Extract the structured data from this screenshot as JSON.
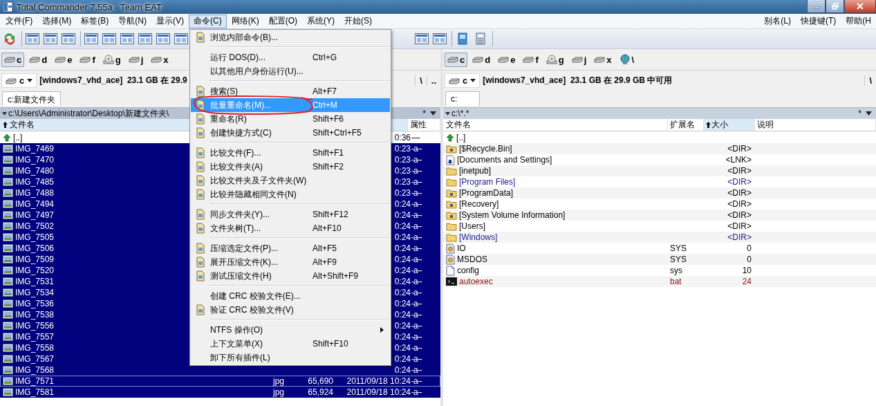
{
  "window": {
    "title": "Total Commander 7.55a - Team EAT"
  },
  "menubar": {
    "left": [
      {
        "label": "文件(F)",
        "selected": false
      },
      {
        "label": "选择(M)",
        "selected": false
      },
      {
        "label": "标签(B)",
        "selected": false
      },
      {
        "label": "导航(N)",
        "selected": false
      },
      {
        "label": "显示(V)",
        "selected": false
      },
      {
        "label": "命令(C)",
        "selected": true
      },
      {
        "label": "网络(K)",
        "selected": false
      },
      {
        "label": "配置(O)",
        "selected": false
      },
      {
        "label": "系统(Y)",
        "selected": false
      },
      {
        "label": "开始(S)",
        "selected": false
      }
    ],
    "right": [
      {
        "label": "别名(L)",
        "selected": false
      },
      {
        "label": "快捷键(T)",
        "selected": false
      },
      {
        "label": "帮助(H",
        "selected": false
      }
    ]
  },
  "panels": [
    {
      "drives": [
        {
          "label": "c",
          "kind": "hdd",
          "selected": true
        },
        {
          "label": "d",
          "kind": "hdd",
          "selected": false
        },
        {
          "label": "e",
          "kind": "hdd",
          "selected": false
        },
        {
          "label": "f",
          "kind": "hdd",
          "selected": false
        },
        {
          "label": "g",
          "kind": "cd",
          "selected": false
        },
        {
          "label": "j",
          "kind": "hdd",
          "selected": false
        },
        {
          "label": "x",
          "kind": "hdd",
          "selected": false
        }
      ],
      "drive_select": "c",
      "info": "[windows7_vhd_ace]  23.1 GB 在 29.9",
      "nav_buttons": [
        "\\",
        ".."
      ],
      "tab": "c:新建文件夹",
      "path": "c:\\Users\\Administrator\\Desktop\\新建文件夹\\",
      "active": true,
      "filter": "*",
      "columns": [
        {
          "label": "文件名",
          "kind": "name",
          "sorted": true
        },
        {
          "label": "属性",
          "kind": "attr",
          "sorted": false
        }
      ],
      "rows": [
        {
          "kind": "up",
          "name": "[..]",
          "date": "0:36",
          "attr": "----",
          "selected": false,
          "cursor": false
        },
        {
          "kind": "image",
          "name": "IMG_7469",
          "date": "0:23",
          "attr": "-a--",
          "selected": true,
          "cursor": false
        },
        {
          "kind": "image",
          "name": "IMG_7470",
          "date": "0:23",
          "attr": "-a--",
          "selected": true,
          "cursor": false
        },
        {
          "kind": "image",
          "name": "IMG_7480",
          "date": "0:23",
          "attr": "-a--",
          "selected": true,
          "cursor": false
        },
        {
          "kind": "image",
          "name": "IMG_7485",
          "date": "0:23",
          "attr": "-a--",
          "selected": true,
          "cursor": false
        },
        {
          "kind": "image",
          "name": "IMG_7488",
          "date": "0:23",
          "attr": "-a--",
          "selected": true,
          "cursor": false
        },
        {
          "kind": "image",
          "name": "IMG_7494",
          "date": "0:24",
          "attr": "-a--",
          "selected": true,
          "cursor": false
        },
        {
          "kind": "image",
          "name": "IMG_7497",
          "date": "0:24",
          "attr": "-a--",
          "selected": true,
          "cursor": false
        },
        {
          "kind": "image",
          "name": "IMG_7502",
          "date": "0:24",
          "attr": "-a--",
          "selected": true,
          "cursor": false
        },
        {
          "kind": "image",
          "name": "IMG_7505",
          "date": "0:24",
          "attr": "-a--",
          "selected": true,
          "cursor": false
        },
        {
          "kind": "image",
          "name": "IMG_7506",
          "date": "0:24",
          "attr": "-a--",
          "selected": true,
          "cursor": false
        },
        {
          "kind": "image",
          "name": "IMG_7509",
          "date": "0:24",
          "attr": "-a--",
          "selected": true,
          "cursor": false
        },
        {
          "kind": "image",
          "name": "IMG_7520",
          "date": "0:24",
          "attr": "-a--",
          "selected": true,
          "cursor": false
        },
        {
          "kind": "image",
          "name": "IMG_7531",
          "date": "0:24",
          "attr": "-a--",
          "selected": true,
          "cursor": false
        },
        {
          "kind": "image",
          "name": "IMG_7534",
          "date": "0:24",
          "attr": "-a--",
          "selected": true,
          "cursor": false
        },
        {
          "kind": "image",
          "name": "IMG_7536",
          "date": "0:24",
          "attr": "-a--",
          "selected": true,
          "cursor": false
        },
        {
          "kind": "image",
          "name": "IMG_7538",
          "date": "0:24",
          "attr": "-a--",
          "selected": true,
          "cursor": false
        },
        {
          "kind": "image",
          "name": "IMG_7556",
          "date": "0:24",
          "attr": "-a--",
          "selected": true,
          "cursor": false
        },
        {
          "kind": "image",
          "name": "IMG_7557",
          "date": "0:24",
          "attr": "-a--",
          "selected": true,
          "cursor": false
        },
        {
          "kind": "image",
          "name": "IMG_7558",
          "date": "0:24",
          "attr": "-a--",
          "selected": true,
          "cursor": false
        },
        {
          "kind": "image",
          "name": "IMG_7567",
          "date": "0:24",
          "attr": "-a--",
          "selected": true,
          "cursor": false
        },
        {
          "kind": "image",
          "name": "IMG_7568",
          "date": "0:24",
          "attr": "-a--",
          "selected": true,
          "cursor": false
        },
        {
          "kind": "image",
          "name": "IMG_7571",
          "ext": "jpg",
          "size": "65,690",
          "date": "2011/09/18 10:24",
          "attr": "-a--",
          "selected": true,
          "cursor": true
        },
        {
          "kind": "image",
          "name": "IMG_7581",
          "ext": "jpg",
          "size": "65,924",
          "date": "2011/09/18 10:24",
          "attr": "-a--",
          "selected": true,
          "cursor": false
        }
      ]
    },
    {
      "drives": [
        {
          "label": "c",
          "kind": "hdd",
          "selected": true
        },
        {
          "label": "d",
          "kind": "hdd",
          "selected": false
        },
        {
          "label": "e",
          "kind": "hdd",
          "selected": false
        },
        {
          "label": "f",
          "kind": "hdd",
          "selected": false
        },
        {
          "label": "g",
          "kind": "cd",
          "selected": false
        },
        {
          "label": "j",
          "kind": "hdd",
          "selected": false
        },
        {
          "label": "x",
          "kind": "hdd",
          "selected": false
        },
        {
          "label": "\\",
          "kind": "network",
          "selected": false
        }
      ],
      "drive_select": "c",
      "info": "[windows7_vhd_ace]  23.1 GB 在 29.9 GB 中可用",
      "nav_buttons": [
        "\\"
      ],
      "tab": "c:",
      "path": "c:\\*.*",
      "active": false,
      "filter": "*",
      "columns": [
        {
          "label": "文件名",
          "kind": "name",
          "sorted": false
        },
        {
          "label": "扩展名",
          "kind": "ext",
          "sorted": false
        },
        {
          "label": "大小",
          "kind": "size",
          "sorted": true
        },
        {
          "label": "说明",
          "kind": "desc",
          "sorted": false
        }
      ],
      "rows": [
        {
          "kind": "up",
          "name": "[..]",
          "selected": false,
          "cursor": false
        },
        {
          "kind": "system-folder",
          "name": "[$Recycle.Bin]",
          "size": "<DIR>",
          "selected": false,
          "cursor": false
        },
        {
          "kind": "link",
          "name": "[Documents and Settings]",
          "size": "<LNK>",
          "selected": false,
          "cursor": false
        },
        {
          "kind": "folder",
          "name": "[inetpub]",
          "size": "<DIR>",
          "selected": false,
          "cursor": false
        },
        {
          "kind": "folder",
          "name": "[Program Files]",
          "size": "<DIR>",
          "color": "#1a1a8c",
          "selected": false,
          "cursor": false
        },
        {
          "kind": "system-folder",
          "name": "[ProgramData]",
          "size": "<DIR>",
          "selected": false,
          "cursor": false
        },
        {
          "kind": "system-folder",
          "name": "[Recovery]",
          "size": "<DIR>",
          "selected": false,
          "cursor": false
        },
        {
          "kind": "system-folder",
          "name": "[System Volume Information]",
          "size": "<DIR>",
          "selected": false,
          "cursor": false
        },
        {
          "kind": "folder",
          "name": "[Users]",
          "size": "<DIR>",
          "selected": false,
          "cursor": false
        },
        {
          "kind": "folder",
          "name": "[Windows]",
          "size": "<DIR>",
          "color": "#1a1a8c",
          "selected": false,
          "cursor": false
        },
        {
          "kind": "system-file",
          "name": "IO",
          "ext": "SYS",
          "size": "0",
          "selected": false,
          "cursor": false
        },
        {
          "kind": "system-file",
          "name": "MSDOS",
          "ext": "SYS",
          "size": "0",
          "selected": false,
          "cursor": false
        },
        {
          "kind": "file",
          "name": "config",
          "ext": "sys",
          "size": "10",
          "selected": false,
          "cursor": false
        },
        {
          "kind": "batch",
          "name": "autoexec",
          "ext": "bat",
          "size": "24",
          "color": "#8b1010",
          "selected": false,
          "cursor": false
        }
      ]
    }
  ],
  "command_menu": [
    {
      "kind": "command",
      "label": "浏览内部命令(B)...",
      "selected": false,
      "circled": false
    },
    {
      "kind": "separator"
    },
    {
      "kind": "plain",
      "label": "运行 DOS(D)...",
      "shortcut": "Ctrl+G",
      "selected": false,
      "circled": false
    },
    {
      "kind": "plain",
      "label": "以其他用户身份运行(U)...",
      "selected": false,
      "circled": false
    },
    {
      "kind": "separator"
    },
    {
      "kind": "command",
      "label": "搜索(S)",
      "shortcut": "Alt+F7",
      "selected": false,
      "circled": false
    },
    {
      "kind": "command",
      "label": "批量重命名(M)...",
      "shortcut": "Ctrl+M",
      "selected": true,
      "circled": true
    },
    {
      "kind": "command",
      "label": "重命名(R)",
      "shortcut": "Shift+F6",
      "selected": false,
      "circled": false
    },
    {
      "kind": "command",
      "label": "创建快捷方式(C)",
      "shortcut": "Shift+Ctrl+F5",
      "selected": false,
      "circled": false
    },
    {
      "kind": "separator"
    },
    {
      "kind": "command",
      "label": "比较文件(F)...",
      "shortcut": "Shift+F1",
      "selected": false,
      "circled": false
    },
    {
      "kind": "command",
      "label": "比较文件夹(A)",
      "shortcut": "Shift+F2",
      "selected": false,
      "circled": false
    },
    {
      "kind": "command",
      "label": "比较文件夹及子文件夹(W)",
      "selected": false,
      "circled": false
    },
    {
      "kind": "command",
      "label": "比较并隐藏相同文件(N)",
      "selected": false,
      "circled": false
    },
    {
      "kind": "separator"
    },
    {
      "kind": "command",
      "label": "同步文件夹(Y)...",
      "shortcut": "Shift+F12",
      "selected": false,
      "circled": false
    },
    {
      "kind": "command",
      "label": "文件夹树(T)...",
      "shortcut": "Alt+F10",
      "selected": false,
      "circled": false
    },
    {
      "kind": "separator"
    },
    {
      "kind": "command",
      "label": "压缩选定文件(P)...",
      "shortcut": "Alt+F5",
      "selected": false,
      "circled": false
    },
    {
      "kind": "command",
      "label": "展开压缩文件(K)...",
      "shortcut": "Alt+F9",
      "selected": false,
      "circled": false
    },
    {
      "kind": "command",
      "label": "测试压缩文件(H)",
      "shortcut": "Alt+Shift+F9",
      "selected": false,
      "circled": false
    },
    {
      "kind": "separator"
    },
    {
      "kind": "plain",
      "label": "创建 CRC 校验文件(E)...",
      "selected": false,
      "circled": false
    },
    {
      "kind": "command",
      "label": "验证 CRC 校验文件(V)",
      "selected": false,
      "circled": false
    },
    {
      "kind": "separator"
    },
    {
      "kind": "submenu",
      "label": "NTFS 操作(O)",
      "selected": false,
      "circled": false
    },
    {
      "kind": "plain",
      "label": "上下文菜单(X)",
      "shortcut": "Shift+F10",
      "selected": false,
      "circled": false
    },
    {
      "kind": "plain",
      "label": "卸下所有插件(L)",
      "selected": false,
      "circled": false
    }
  ]
}
